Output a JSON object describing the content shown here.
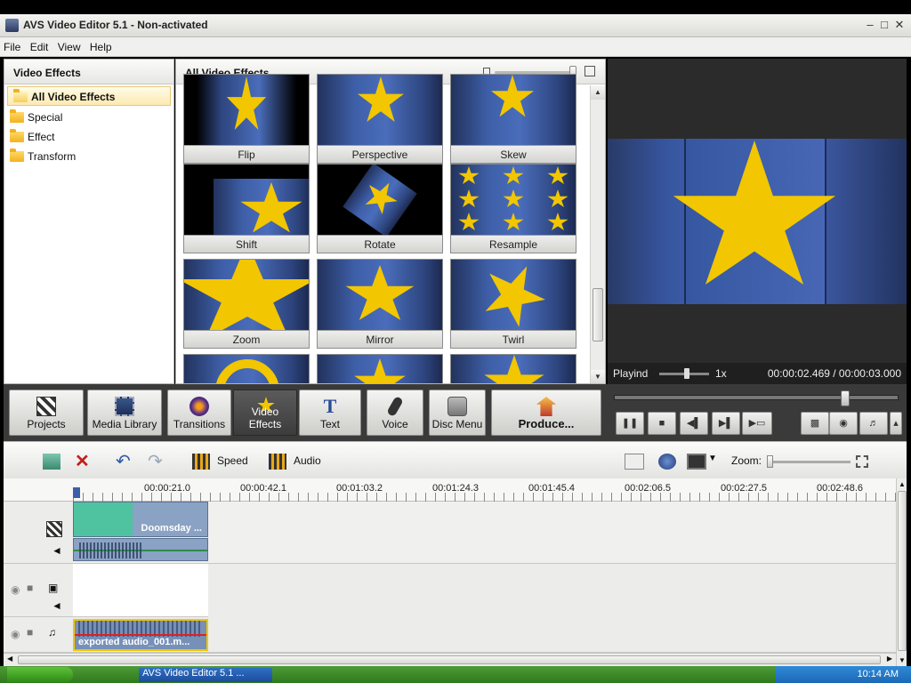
{
  "window": {
    "title": "AVS Video Editor 5.1 - Non-activated"
  },
  "menu": [
    "File",
    "Edit",
    "View",
    "Help"
  ],
  "left_panel": {
    "header": "Video Effects",
    "items": [
      "All Video Effects",
      "Special",
      "Effect",
      "Transform"
    ],
    "selected": "All Video Effects"
  },
  "grid": {
    "header": "All Video Effects",
    "tiles": [
      "Flip",
      "Perspective",
      "Skew",
      "Shift",
      "Rotate",
      "Resample",
      "Zoom",
      "Mirror",
      "Twirl"
    ]
  },
  "preview": {
    "state": "Playind",
    "speed": "1x",
    "time": "00:00:02.469 / 00:00:03.000",
    "seek_position": 0.82
  },
  "toolbar": {
    "buttons": [
      "Projects",
      "Media Library",
      "Transitions",
      "Video Effects",
      "Text",
      "Voice",
      "Disc Menu",
      "Produce..."
    ],
    "active": "Video Effects"
  },
  "timeline_toolbar": {
    "speed_label": "Speed",
    "audio_label": "Audio",
    "zoom_label": "Zoom:"
  },
  "ruler": {
    "ticks": [
      "00:00:21.0",
      "00:00:42.1",
      "00:01:03.2",
      "00:01:24.3",
      "00:01:45.4",
      "00:02:06.5",
      "00:02:27.5",
      "00:02:48.6"
    ]
  },
  "tracks": {
    "video_clip_label": "Doomsday ...",
    "audio_clip_label": "exported audio_001.m..."
  },
  "taskbar": {
    "task_label": "AVS Video Editor 5.1 ...",
    "clock": "10:14 AM"
  },
  "colors": {
    "star": "#f2c600",
    "blue": "#3e5fa8",
    "dark": "#3a3a3a",
    "green": "#4fc3a0"
  }
}
